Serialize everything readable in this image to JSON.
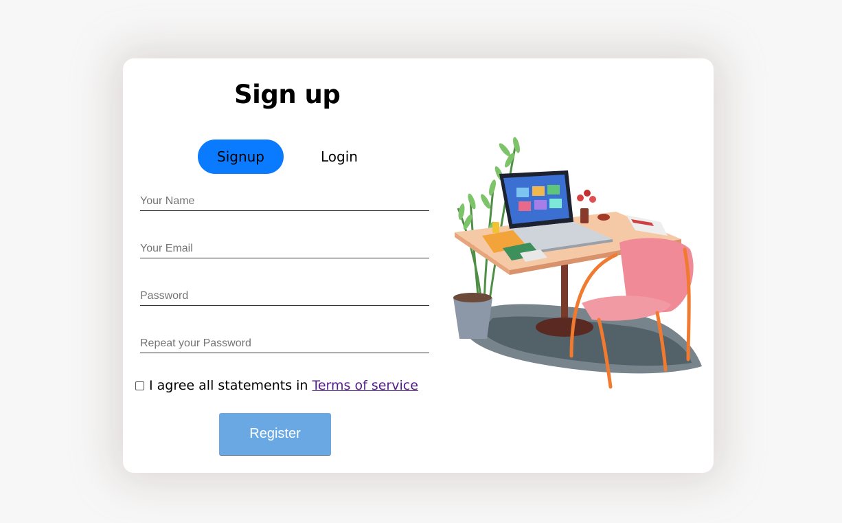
{
  "form": {
    "title": "Sign up",
    "tabs": {
      "signup": "Signup",
      "login": "Login"
    },
    "fields": {
      "name_placeholder": "Your Name",
      "email_placeholder": "Your Email",
      "password_placeholder": "Password",
      "repeat_password_placeholder": "Repeat your Password"
    },
    "agree_text": "I agree all statements in",
    "terms_link": "Terms of service",
    "register_label": "Register"
  },
  "colors": {
    "active_tab": "#0a7bff",
    "register_button": "#6aa8e3",
    "link": "#551a8b"
  },
  "illustration": {
    "icon": "desk-workspace-illustration"
  }
}
